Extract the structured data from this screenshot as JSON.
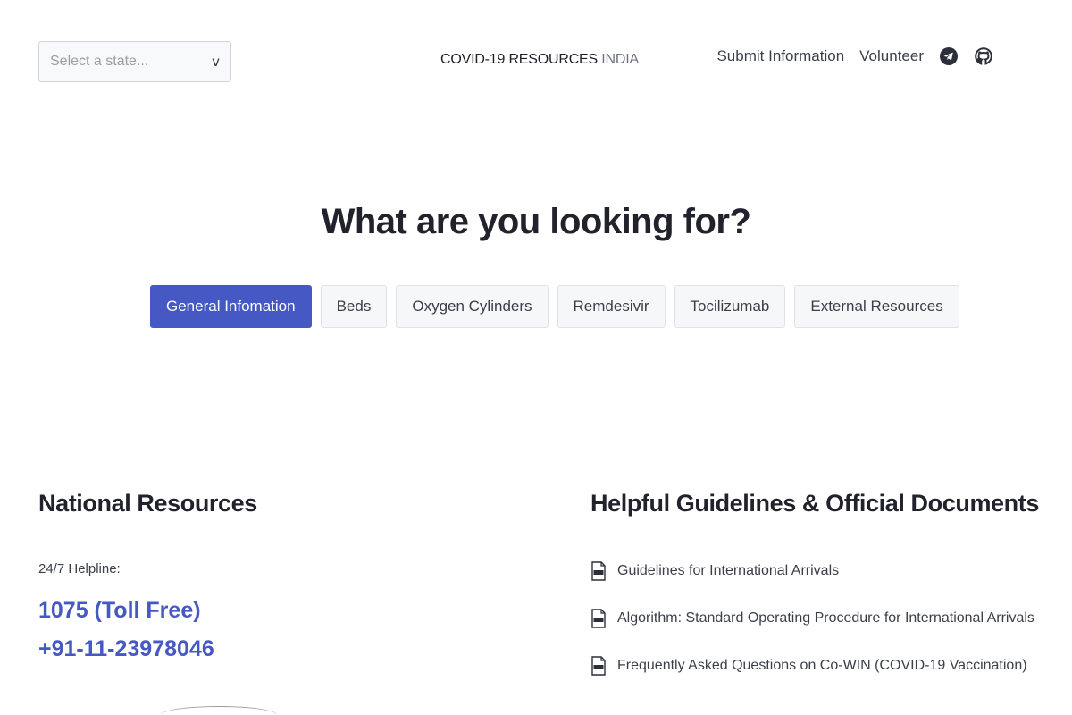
{
  "header": {
    "state_select": {
      "placeholder": "Select a state...",
      "chevron": "v"
    },
    "brand": {
      "part1": "COVID-19 RESOURCES",
      "part2": "INDIA"
    },
    "nav": {
      "submit": "Submit Information",
      "volunteer": "Volunteer",
      "icons": [
        "telegram-icon",
        "github-icon"
      ]
    }
  },
  "hero": {
    "title": "What are you looking for?",
    "tabs": [
      {
        "label": "General Infomation",
        "active": true
      },
      {
        "label": "Beds",
        "active": false
      },
      {
        "label": "Oxygen Cylinders",
        "active": false
      },
      {
        "label": "Remdesivir",
        "active": false
      },
      {
        "label": "Tocilizumab",
        "active": false
      },
      {
        "label": "External Resources",
        "active": false
      }
    ]
  },
  "national": {
    "title": "National Resources",
    "helpline_label": "24/7 Helpline:",
    "phone1": "1075 (Toll Free)",
    "phone2": "+91-11-23978046"
  },
  "guidelines": {
    "title": "Helpful Guidelines & Official Documents",
    "items": [
      {
        "label": "Guidelines for International Arrivals",
        "icon": "pdf-icon"
      },
      {
        "label": "Algorithm: Standard Operating Procedure for International Arrivals",
        "icon": "pdf-icon"
      },
      {
        "label": "Frequently Asked Questions on Co-WIN (COVID-19 Vaccination)",
        "icon": "pdf-icon"
      }
    ]
  },
  "colors": {
    "accent": "#4558c3",
    "text": "#22222c",
    "muted": "#6f7380"
  }
}
